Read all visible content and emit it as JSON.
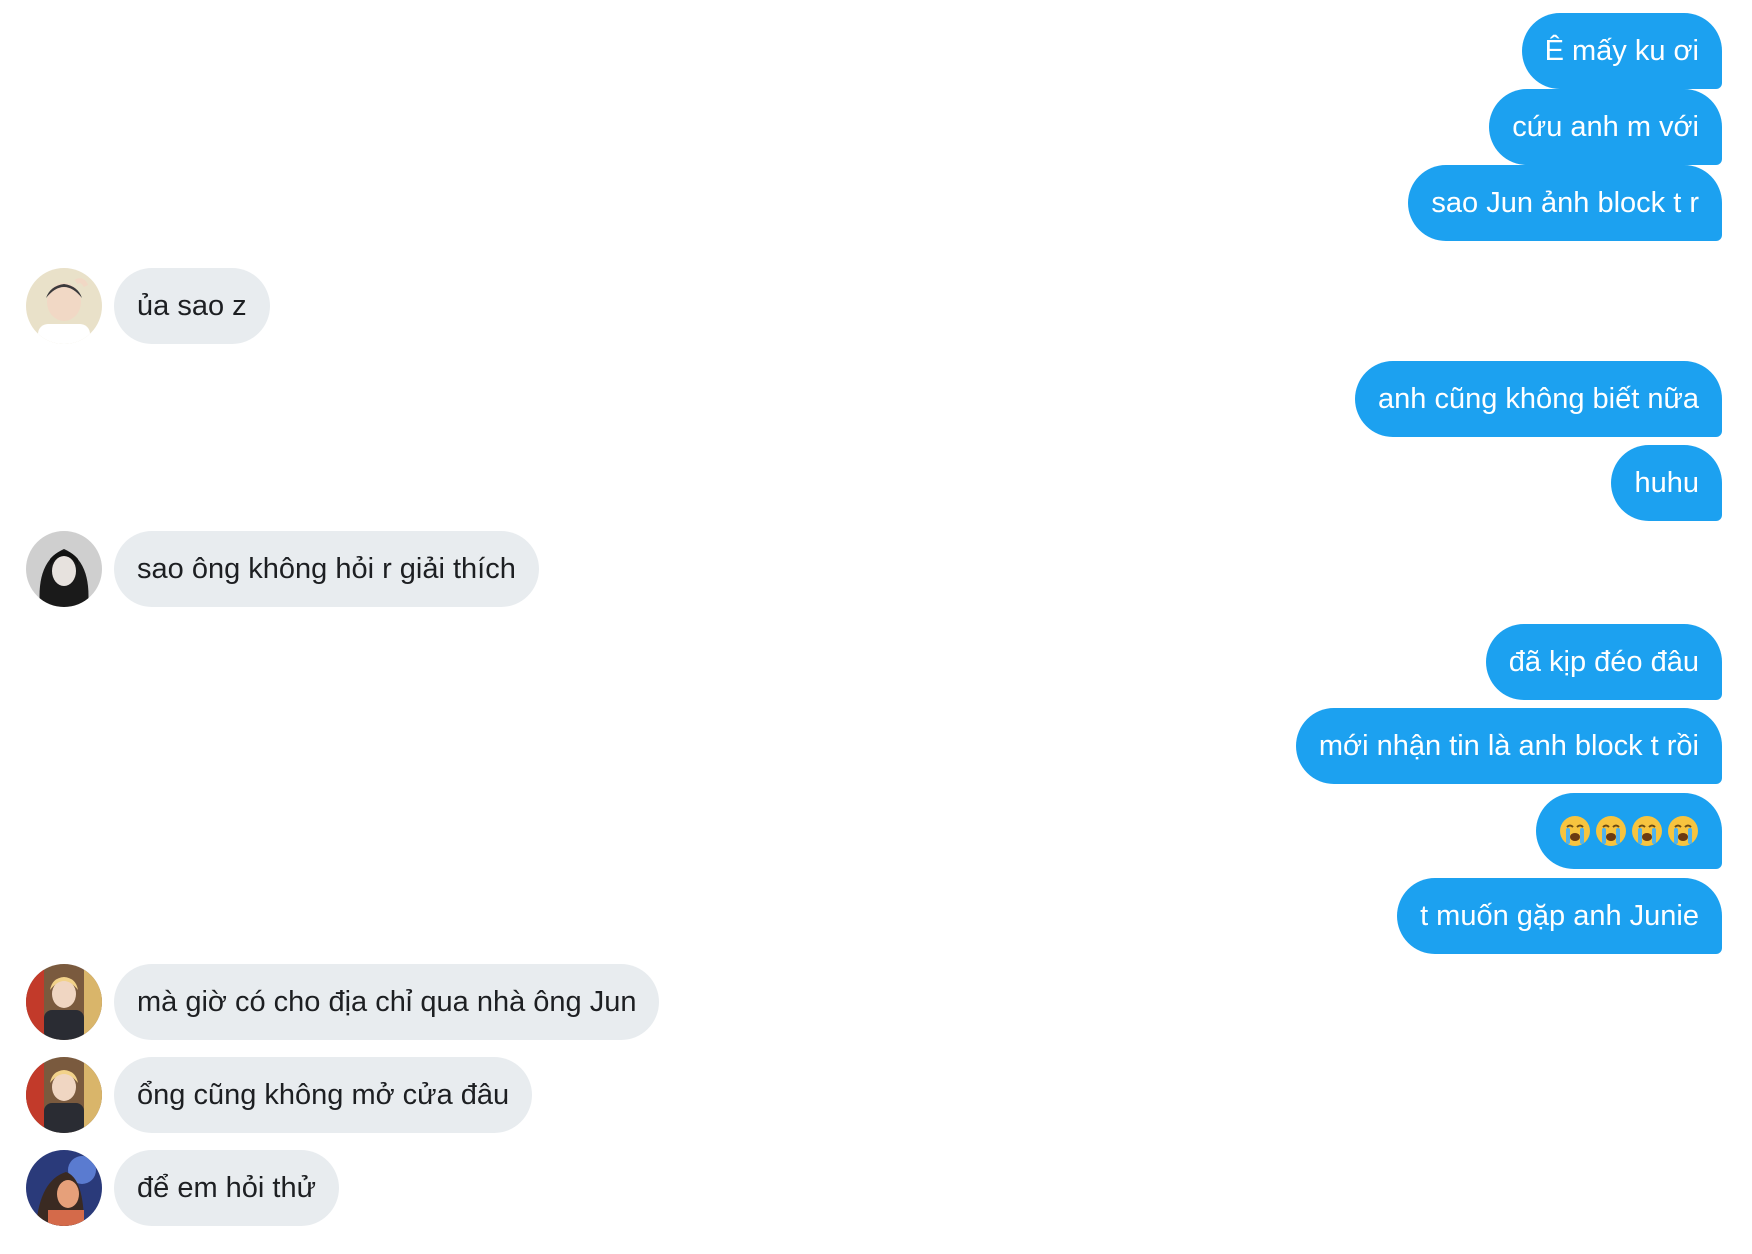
{
  "conversation": {
    "outgoing": [
      "Ê mấy ku ơi",
      "cứu anh m với",
      "sao Jun ảnh block t r",
      "anh cũng không biết nữa",
      "huhu",
      "đã kịp đéo đâu",
      "mới nhận tin là anh block t rồi",
      "😭😭😭😭",
      "t muốn gặp anh Junie"
    ],
    "incoming": [
      "ủa sao z",
      "sao ông không hỏi r giải thích",
      "mà giờ có cho địa chỉ qua nhà ông Jun",
      "ổng cũng không mở cửa đâu",
      "để em hỏi thử"
    ]
  },
  "colors": {
    "outgoing_bubble": "#1ca1f0",
    "incoming_bubble": "#e8ecef",
    "outgoing_text": "#ffffff",
    "incoming_text": "#1d1f22"
  },
  "icons": {
    "avatar": "user-avatar-photo",
    "emoji": "loudly-crying-face-icon"
  }
}
